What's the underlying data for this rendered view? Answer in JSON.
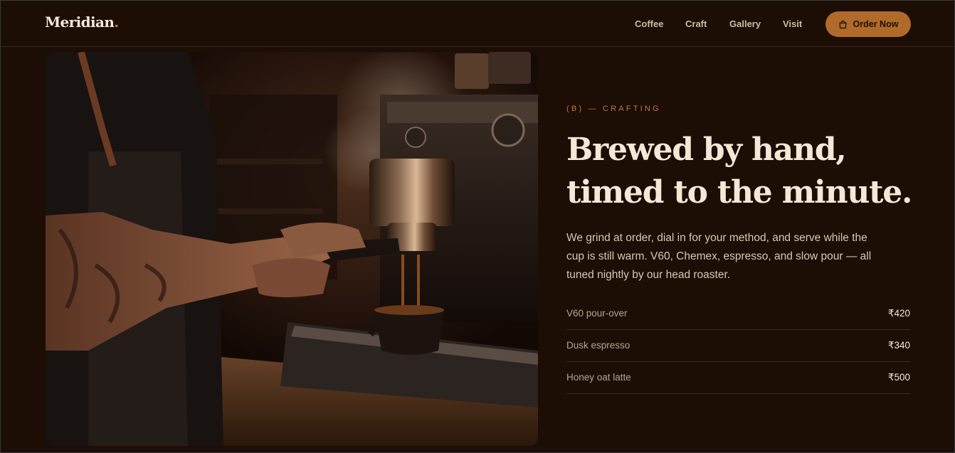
{
  "brand": {
    "name": "Meridian",
    "dot": "."
  },
  "nav": {
    "links": [
      "Coffee",
      "Craft",
      "Gallery",
      "Visit"
    ],
    "cta": "Order Now",
    "cta_icon": "shopping-bag-icon"
  },
  "hero_image": {
    "subject": "barista-pulling-espresso-shot-photo"
  },
  "section": {
    "eyebrow": "(B) — CRAFTING",
    "headline": [
      "Brewed by hand,",
      "timed to the minute."
    ],
    "body": "We grind at order, dial in for your method, and serve while the cup is still warm. V60, Chemex, espresso, and slow pour — all tuned nightly by our head roaster.",
    "menu": [
      {
        "name": "V60 pour-over",
        "price": "₹420"
      },
      {
        "name": "Dusk espresso",
        "price": "₹340"
      },
      {
        "name": "Honey oat latte",
        "price": "₹500"
      }
    ]
  },
  "colors": {
    "background": "#1c0d05",
    "accent": "#b06a2a",
    "eyebrow": "#c47a32",
    "heading": "#f4e8d6",
    "muted": "#b7a491"
  }
}
